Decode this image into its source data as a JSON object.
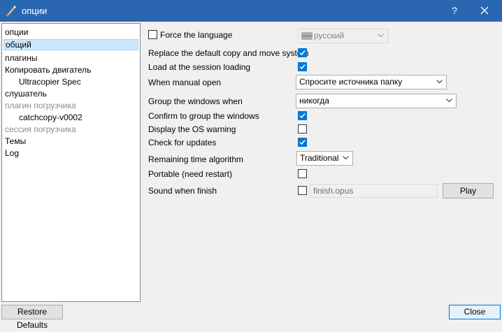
{
  "window": {
    "title": "опции",
    "help_glyph": "?",
    "close_glyph": "✕",
    "accent": "#2b67b1"
  },
  "sidebar": {
    "items": [
      {
        "label": "опции",
        "state": "normal"
      },
      {
        "label": "общий",
        "state": "selected"
      },
      {
        "label": "плагины",
        "state": "normal"
      },
      {
        "label": "Копировать двигатель",
        "state": "normal"
      },
      {
        "label": "Ultracopier Spec",
        "state": "normal"
      },
      {
        "label": "слушатель",
        "state": "normal"
      },
      {
        "label": "плагин погрузчика",
        "state": "disabled"
      },
      {
        "label": "catchcopy-v0002",
        "state": "normal"
      },
      {
        "label": "сессия погрузчика",
        "state": "disabled"
      },
      {
        "label": "Темы",
        "state": "normal"
      },
      {
        "label": "Log",
        "state": "normal"
      }
    ]
  },
  "settings": {
    "force_language": {
      "label": "Force the language",
      "checked": false,
      "language": "русский"
    },
    "replace_default": {
      "label": "Replace the default copy and move system",
      "checked": true
    },
    "load_session": {
      "label": "Load at the session loading",
      "checked": true
    },
    "manual_open": {
      "label": "When manual open",
      "value": "Спросите источника папку"
    },
    "group_windows": {
      "label": "Group the windows when",
      "value": "никогда"
    },
    "confirm_group": {
      "label": "Confirm to group the windows",
      "checked": true
    },
    "os_warning": {
      "label": "Display the OS warning",
      "checked": false
    },
    "check_updates": {
      "label": "Check for updates",
      "checked": true
    },
    "remaining_time": {
      "label": "Remaining time algorithm",
      "value": "Traditional"
    },
    "portable": {
      "label": "Portable (need restart)",
      "checked": false
    },
    "sound_finish": {
      "label": "Sound when finish",
      "checked": false,
      "file": "finish.opus",
      "play_label": "Play"
    }
  },
  "footer": {
    "restore_label": "Restore Defaults",
    "close_label": "Close"
  }
}
